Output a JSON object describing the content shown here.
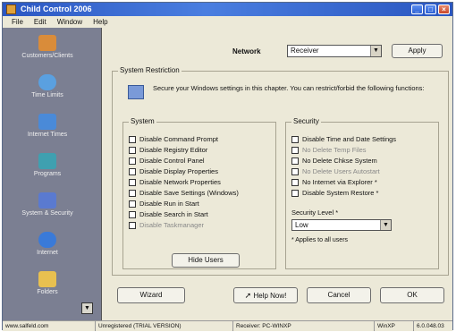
{
  "window": {
    "title": "Child Control 2006"
  },
  "window_buttons": {
    "minimize": "_",
    "maximize": "□",
    "close": "×"
  },
  "menu": [
    "File",
    "Edit",
    "Window",
    "Help"
  ],
  "sidebar": {
    "items": [
      {
        "label": "Customers/Clients",
        "icon": "people-icon",
        "color": "#d98c3a"
      },
      {
        "label": "Time Limits",
        "icon": "clock-icon",
        "color": "#5aa0e0"
      },
      {
        "label": "Internet Times",
        "icon": "monitor-icon",
        "color": "#4a8ad8"
      },
      {
        "label": "Programs",
        "icon": "programs-icon",
        "color": "#3fa0b0"
      },
      {
        "label": "System & Security",
        "icon": "shield-icon",
        "color": "#5a7ad0"
      },
      {
        "label": "Internet",
        "icon": "globe-icon",
        "color": "#3a7ad8"
      },
      {
        "label": "Folders",
        "icon": "folder-icon",
        "color": "#e8c050"
      }
    ]
  },
  "network": {
    "label": "Network",
    "value": "Receiver",
    "apply_label": "Apply"
  },
  "restrictions": {
    "title": "System Restriction",
    "description": "Secure your Windows settings in this chapter. You can restrict/forbid the following functions:"
  },
  "system_group": {
    "title": "System",
    "items": [
      "Disable Command Prompt",
      "Disable Registry Editor",
      "Disable Control Panel",
      "Disable Display Properties",
      "Disable Network Properties",
      "Disable Save Settings (Windows)",
      "Disable Run in Start",
      "Disable Search in Start",
      "Disable Taskmanager"
    ],
    "hide_users_label": "Hide Users"
  },
  "security_group": {
    "title": "Security",
    "items": [
      "Disable Time and Date Settings",
      "No Delete Temp Files",
      "No Delete Chkse System",
      "No Delete Users Autostart",
      "No Internet via Explorer *",
      "Disable System Restore *"
    ],
    "level_label": "Security Level *",
    "level_value": "Low",
    "note": "* Applies to all users"
  },
  "bottom_buttons": {
    "wizard": "Wizard",
    "help": "Help Now!",
    "cancel": "Cancel",
    "ok": "OK"
  },
  "status": {
    "cells": [
      "www.salfeld.com",
      "Unregistered (TRIAL VERSION)",
      "Receiver: PC-WINXP",
      "WinXP",
      "6.0.048.03"
    ]
  }
}
